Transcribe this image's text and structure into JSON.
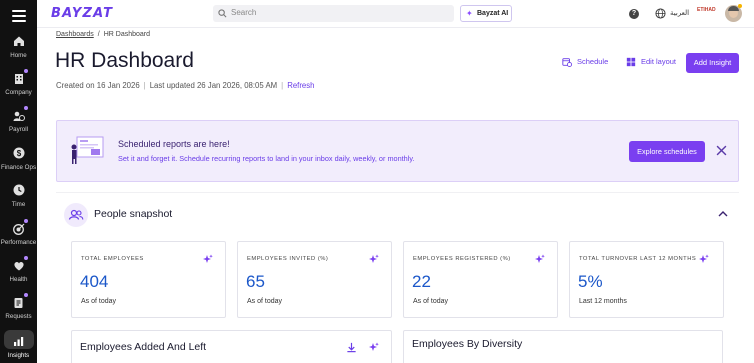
{
  "sidebar": {
    "items": [
      {
        "label": "Home",
        "icon": "home-icon"
      },
      {
        "label": "Company",
        "icon": "building-icon"
      },
      {
        "label": "Payroll",
        "icon": "payroll-icon"
      },
      {
        "label": "Finance Ops",
        "icon": "dollar-icon"
      },
      {
        "label": "Time",
        "icon": "clock-icon"
      },
      {
        "label": "Performance",
        "icon": "target-icon"
      },
      {
        "label": "Health",
        "icon": "health-icon"
      },
      {
        "label": "Requests",
        "icon": "requests-icon"
      },
      {
        "label": "Insights",
        "icon": "chart-icon",
        "active": true
      }
    ]
  },
  "topbar": {
    "logo": "BAYZAT",
    "search_placeholder": "Search",
    "ai_label": "Bayzat AI",
    "help_glyph": "?",
    "language": "العربية",
    "company_logo_text": "ETIHAD"
  },
  "header": {
    "breadcrumb_root": "Dashboards",
    "breadcrumb_current": "HR Dashboard",
    "title": "HR Dashboard",
    "created": "Created on 16 Jan 2026",
    "updated": "Last updated 26 Jan 2026, 08:05 AM",
    "refresh": "Refresh",
    "schedule": "Schedule",
    "edit_layout": "Edit layout",
    "add_insight": "Add Insight"
  },
  "banner": {
    "title": "Scheduled reports are here!",
    "text": "Set it and forget it. Schedule recurring reports to land in your inbox daily, weekly, or monthly.",
    "button": "Explore schedules"
  },
  "snapshot": {
    "title": "People snapshot",
    "cards": [
      {
        "label": "Total Employees",
        "value": "404",
        "sub": "As of today"
      },
      {
        "label": "Employees Invited (%)",
        "value": "65",
        "sub": "As of today"
      },
      {
        "label": "Employees Registered (%)",
        "value": "22",
        "sub": "As of today"
      },
      {
        "label": "Total Turnover Last 12 Months",
        "value": "5%",
        "sub": "Last 12 months"
      }
    ],
    "panels": [
      {
        "title": "Employees Added And Left"
      },
      {
        "title": "Employees By Diversity"
      }
    ]
  },
  "colors": {
    "accent": "#7a3ff0",
    "link": "#6a3de8",
    "value_blue": "#1b57c9",
    "sidebar_bg": "#111111",
    "banner_bg": "#f2edfc"
  }
}
